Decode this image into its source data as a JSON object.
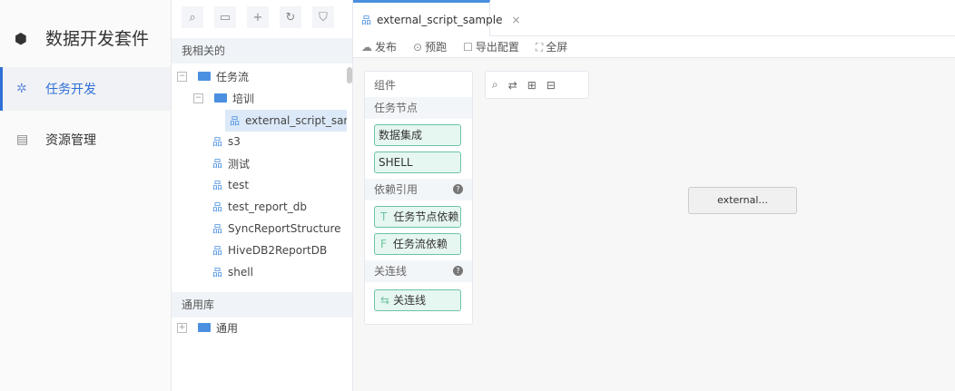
{
  "app": {
    "title": "数据开发套件",
    "logo_icon": "hexagon-logo-icon"
  },
  "nav": [
    {
      "label": "任务开发",
      "icon": "network-icon",
      "active": true
    },
    {
      "label": "资源管理",
      "icon": "folder-stack-icon",
      "active": false
    }
  ],
  "tree": {
    "toolbar": [
      "search-icon",
      "folder-icon",
      "plus-icon",
      "refresh-icon",
      "filter-icon"
    ],
    "mine_header": "我相关的",
    "root": "任务流",
    "sub": "培训",
    "selected": "external_script_sample",
    "flows": [
      "s3",
      "测试",
      "test",
      "test_report_db",
      "SyncReportStructure",
      "HiveDB2ReportDB",
      "shell"
    ],
    "common_header": "通用库",
    "common_folder": "通用"
  },
  "tab": {
    "label": "external_script_sample",
    "close": "×"
  },
  "actions": [
    {
      "label": "发布",
      "icon": "cloud-icon"
    },
    {
      "label": "预跑",
      "icon": "play-circle-icon"
    },
    {
      "label": "导出配置",
      "icon": "export-icon"
    },
    {
      "label": "全屏",
      "icon": "fullscreen-icon"
    }
  ],
  "components": {
    "title": "组件",
    "task_nodes": "任务节点",
    "nodes": [
      "数据集成",
      "SHELL"
    ],
    "deps": "依赖引用",
    "dep_items": [
      {
        "prefix": "T",
        "label": "任务节点依赖"
      },
      {
        "prefix": "F",
        "label": "任务流依赖"
      }
    ],
    "links": "关连线",
    "link_item": "关连线",
    "help": "?"
  },
  "canvas": {
    "node": "external..."
  },
  "colors": {
    "accent": "#2f6fd6",
    "chip": "#6dc4a2"
  }
}
